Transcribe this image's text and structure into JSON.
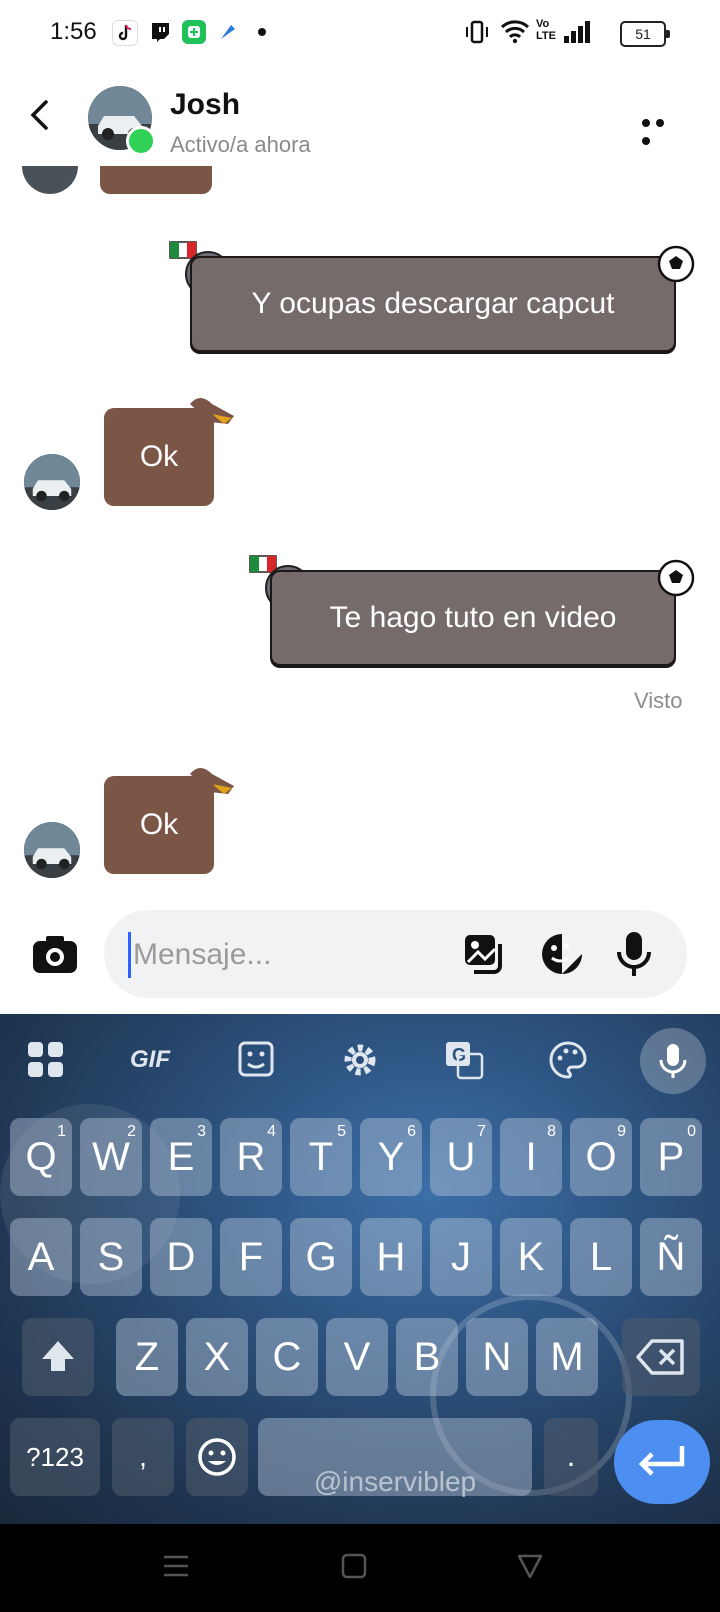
{
  "status_bar": {
    "time": "1:56",
    "battery": "51",
    "icons": [
      "tiktok-icon",
      "twitch-icon",
      "notification-app-icon",
      "app-icon",
      "dot-icon",
      "vibrate-icon",
      "wifi-icon",
      "volte-icon",
      "signal-icon",
      "battery-icon"
    ]
  },
  "header": {
    "contact_name": "Josh",
    "contact_status": "Activo/a ahora"
  },
  "messages": [
    {
      "from": "me",
      "text": "Y ocupas descargar capcut"
    },
    {
      "from": "contact",
      "text": "Ok"
    },
    {
      "from": "me",
      "text": "Te hago tuto en video"
    },
    {
      "from": "contact",
      "text": "Ok"
    }
  ],
  "seen_label": "Visto",
  "composer": {
    "placeholder": "Mensaje..."
  },
  "keyboard": {
    "toolbar": {
      "gif": "GIF"
    },
    "row1": [
      {
        "k": "Q",
        "n": "1"
      },
      {
        "k": "W",
        "n": "2"
      },
      {
        "k": "E",
        "n": "3"
      },
      {
        "k": "R",
        "n": "4"
      },
      {
        "k": "T",
        "n": "5"
      },
      {
        "k": "Y",
        "n": "6"
      },
      {
        "k": "U",
        "n": "7"
      },
      {
        "k": "I",
        "n": "8"
      },
      {
        "k": "O",
        "n": "9"
      },
      {
        "k": "P",
        "n": "0"
      }
    ],
    "row2": [
      "A",
      "S",
      "D",
      "F",
      "G",
      "H",
      "J",
      "K",
      "L",
      "Ñ"
    ],
    "row3": [
      "Z",
      "X",
      "C",
      "V",
      "B",
      "N",
      "M"
    ],
    "symbols_label": "?123",
    "comma": ",",
    "period": ".",
    "watermark": "@inserviblep"
  },
  "colors": {
    "bubble": "#766b6b",
    "dog_sticker": "#7b5546",
    "online": "#31d158",
    "enter_key": "#4c8ff0"
  }
}
